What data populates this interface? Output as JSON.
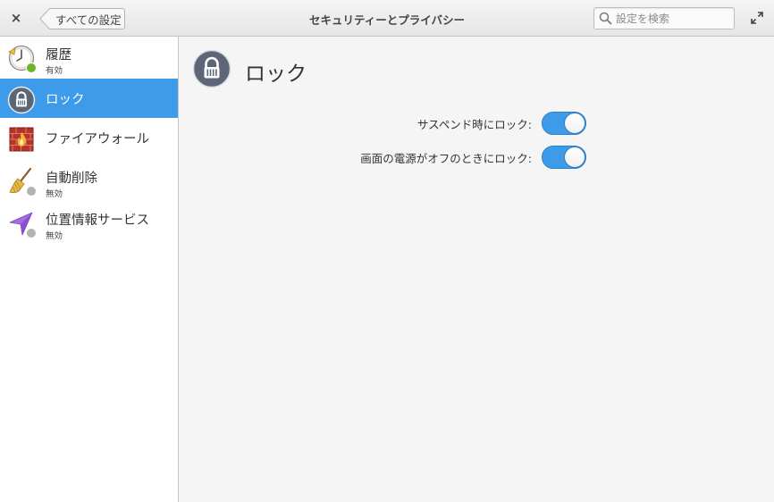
{
  "header": {
    "title": "セキュリティーとプライバシー",
    "back_label": "すべての設定",
    "search_placeholder": "設定を検索",
    "close_glyph": "×"
  },
  "sidebar": {
    "items": [
      {
        "id": "history",
        "label": "履歴",
        "status": "有効",
        "status_color": "#68b723",
        "icon": "history-clock-icon"
      },
      {
        "id": "lock",
        "label": "ロック",
        "status": "",
        "icon": "padlock-icon",
        "selected": true
      },
      {
        "id": "firewall",
        "label": "ファイアウォール",
        "status": "",
        "icon": "firewall-icon"
      },
      {
        "id": "cleanup",
        "label": "自動削除",
        "status": "無効",
        "status_color": "#b3b3b3",
        "icon": "broom-icon"
      },
      {
        "id": "location",
        "label": "位置情報サービス",
        "status": "無効",
        "status_color": "#b3b3b3",
        "icon": "location-arrow-icon"
      }
    ]
  },
  "main": {
    "title": "ロック",
    "settings": [
      {
        "label": "サスペンド時にロック:",
        "enabled": true
      },
      {
        "label": "画面の電源がオフのときにロック:",
        "enabled": true
      }
    ]
  },
  "colors": {
    "accent": "#3d9bea",
    "enabled_dot": "#68b723",
    "disabled_dot": "#b3b3b3"
  }
}
